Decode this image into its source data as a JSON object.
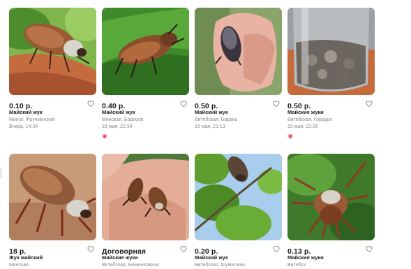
{
  "listings": [
    {
      "price": "0.10 р.",
      "title": "Майский жук",
      "location": "Минск, Фрунзенский",
      "date": "Вчера, 14:34",
      "has_badge": false
    },
    {
      "price": "0.40 р.",
      "title": "Майский жук",
      "location": "Минская, Борисов",
      "date": "16 мая, 22:34",
      "has_badge": true
    },
    {
      "price": "0.50 р.",
      "title": "Майский жук",
      "location": "Витебская, Барань",
      "date": "16 мая, 21:13",
      "has_badge": false
    },
    {
      "price": "0.50 р.",
      "title": "Майские жуки",
      "location": "Витебская, Городок",
      "date": "15 мая, 22:26",
      "has_badge": true
    },
    {
      "price": "18 р.",
      "title": "Жук майский",
      "location": "Минская",
      "date": "",
      "has_badge": false
    },
    {
      "price": "Договорная",
      "title": "Майские жуки",
      "location": "Витебская, Бешенковичи",
      "date": "",
      "has_badge": false
    },
    {
      "price": "0.20 р.",
      "title": "Майский жук",
      "location": "Витебская, Шумилино",
      "date": "",
      "has_badge": false
    },
    {
      "price": "0.13 р.",
      "title": "Майские жуки",
      "location": "Витебск",
      "date": "",
      "has_badge": false
    }
  ],
  "icons": {
    "favorite": "heart-outline-icon",
    "badge": "highlight-badge-icon"
  },
  "colors": {
    "price_text": "#1a1a1a",
    "meta_text": "#8a8a8a",
    "badge": "#e1484f"
  }
}
